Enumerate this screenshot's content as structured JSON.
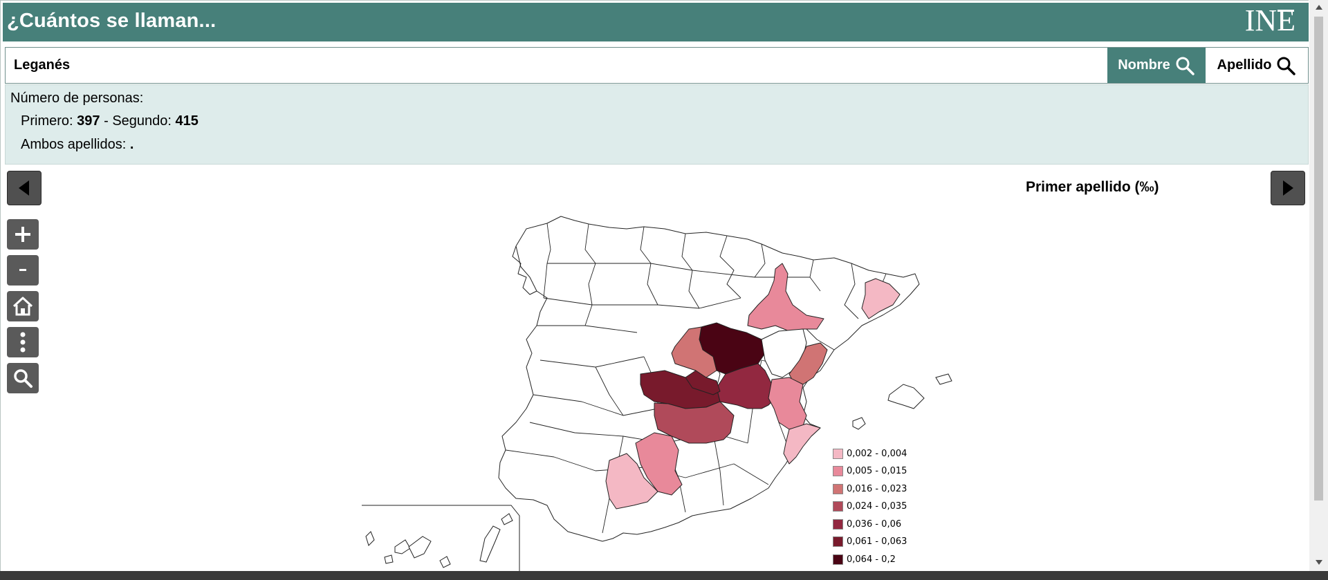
{
  "app": {
    "title": "¿Cuántos se llaman...",
    "logo": "INE"
  },
  "search": {
    "value": "Leganés",
    "nombre_label": "Nombre",
    "apellido_label": "Apellido"
  },
  "results": {
    "heading": "Número de personas:",
    "primero_label": "Primero:",
    "primero_value": "397",
    "separator": "-",
    "segundo_label": "Segundo:",
    "segundo_value": "415",
    "ambos_label": "Ambos apellidos:",
    "ambos_value": "."
  },
  "map": {
    "title": "Primer apellido (‰)",
    "legend": [
      {
        "label": "0,002 - 0,004",
        "color": "#f4b8c4"
      },
      {
        "label": "0,005 - 0,015",
        "color": "#e8899a"
      },
      {
        "label": "0,016 - 0,023",
        "color": "#d07474"
      },
      {
        "label": "0,024 - 0,035",
        "color": "#b04a5a"
      },
      {
        "label": "0,036 - 0,06",
        "color": "#922840"
      },
      {
        "label": "0,061 - 0,063",
        "color": "#781a2c"
      },
      {
        "label": "0,064 - 0,2",
        "color": "#4a0414"
      }
    ]
  },
  "tools": [
    "zoom-in",
    "zoom-out",
    "home",
    "more",
    "search"
  ],
  "colors": {
    "header": "#47807a",
    "results_bg": "#deeceb",
    "tool_bg": "#5a5a5a"
  }
}
